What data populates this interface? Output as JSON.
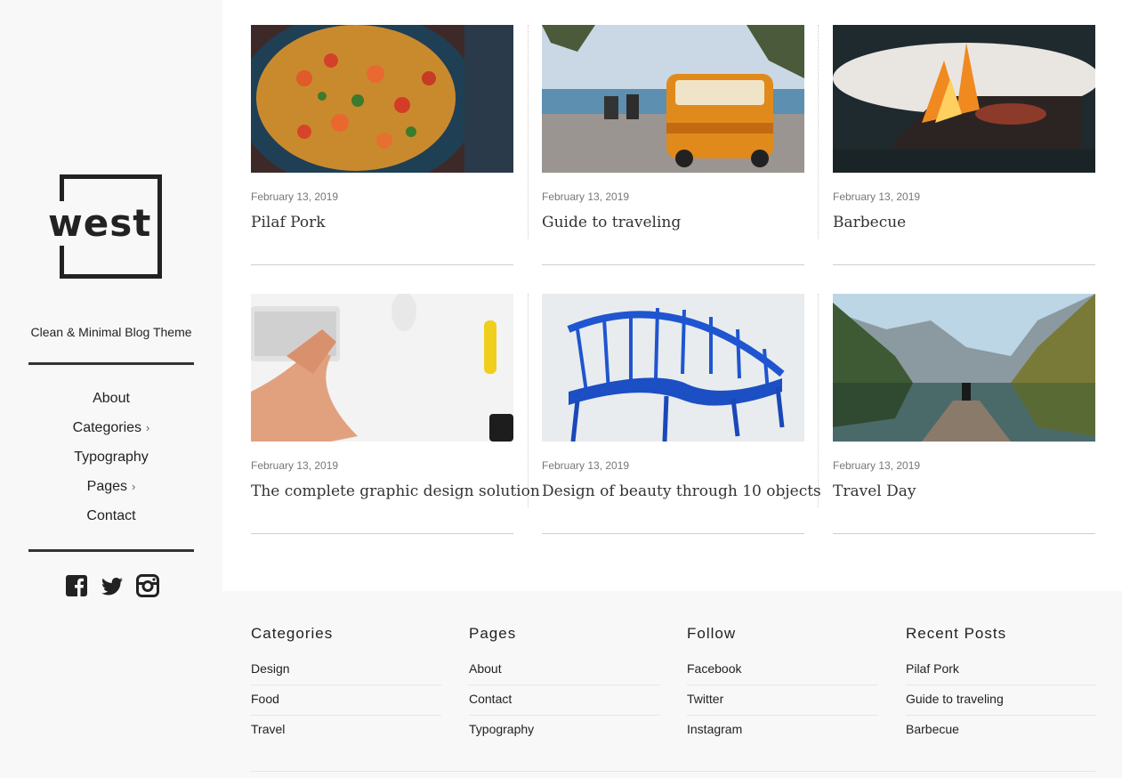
{
  "sidebar": {
    "logo_text": "west",
    "tagline": "Clean & Minimal Blog Theme",
    "nav": [
      {
        "label": "About",
        "chevron": ""
      },
      {
        "label": "Categories",
        "chevron": "›"
      },
      {
        "label": "Typography",
        "chevron": ""
      },
      {
        "label": "Pages",
        "chevron": "›"
      },
      {
        "label": "Contact",
        "chevron": ""
      }
    ],
    "social_icons": [
      "facebook-icon",
      "twitter-icon",
      "instagram-icon"
    ]
  },
  "posts": [
    {
      "date": "February 13, 2019",
      "title": "Pilaf Pork",
      "image": "paella pan photo"
    },
    {
      "date": "February 13, 2019",
      "title": "Guide to traveling",
      "image": "orange van by the sea photo"
    },
    {
      "date": "February 13, 2019",
      "title": "Barbecue",
      "image": "flaming grill photo"
    },
    {
      "date": "February 13, 2019",
      "title": "The complete graphic design solution",
      "image": "hands on keyboard photo"
    },
    {
      "date": "February 13, 2019",
      "title": "Design of beauty through 10 objects",
      "image": "blue chair photo"
    },
    {
      "date": "February 13, 2019",
      "title": "Travel Day",
      "image": "mountain lake pier photo"
    }
  ],
  "footer": {
    "columns": [
      {
        "heading": "Categories",
        "items": [
          "Design",
          "Food",
          "Travel"
        ]
      },
      {
        "heading": "Pages",
        "items": [
          "About",
          "Contact",
          "Typography"
        ]
      },
      {
        "heading": "Follow",
        "items": [
          "Facebook",
          "Twitter",
          "Instagram"
        ]
      },
      {
        "heading": "Recent Posts",
        "items": [
          "Pilaf Pork",
          "Guide to traveling",
          "Barbecue"
        ]
      }
    ]
  },
  "colors": {
    "sidebar_bg": "#f8f8f8",
    "text": "#222222",
    "muted": "#777777"
  }
}
